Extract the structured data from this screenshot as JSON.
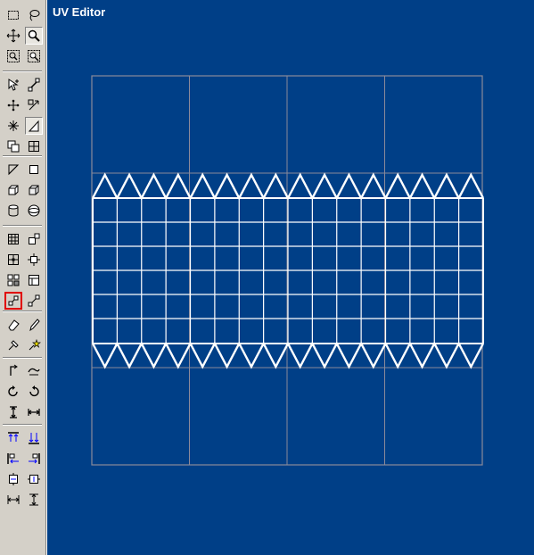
{
  "viewport": {
    "title": "UV Editor",
    "background": "#003f87",
    "grid_color": "#8a8a9a",
    "mesh_color": "#ffffff"
  },
  "toolbar": {
    "active_tool": "uv-scale-tool-icon",
    "active_color": "#e00000",
    "groups": [
      [
        "marquee-select-icon",
        "lasso-select-icon",
        "move-icon",
        "zoom-icon",
        "zoom-region-icon",
        "zoom-extents-icon"
      ],
      [
        "select-vertex-icon",
        "select-edge-icon",
        "select-element-icon",
        "select-region-icon",
        "weld-icon",
        "select-face-icon",
        "cube-select-icon",
        "grid-select-icon"
      ],
      [
        "triangle-face-icon",
        "square-face-icon",
        "box-map-icon",
        "cube-map-icon",
        "cylinder-map-icon",
        "sphere-map-icon"
      ],
      [
        "planar-map-icon",
        "extrude-icon",
        "relax-icon",
        "center-icon",
        "flatten-icon",
        "pack-icon",
        "uv-scale-tool-icon",
        "uv-stretch-icon"
      ],
      [
        "eraser-icon",
        "pencil-icon",
        "pin-icon",
        "star-pin-icon"
      ],
      [
        "rotate-cw-90-icon",
        "rotate-ccw-90-icon",
        "rotate-cw-icon",
        "rotate-ccw-icon",
        "flip-vertical-icon",
        "flip-horizontal-icon"
      ],
      [
        "align-top-icon",
        "align-bottom-icon",
        "align-left-icon",
        "align-right-icon",
        "center-horizontal-icon",
        "center-vertical-icon",
        "space-horizontal-icon",
        "space-vertical-icon"
      ]
    ]
  }
}
